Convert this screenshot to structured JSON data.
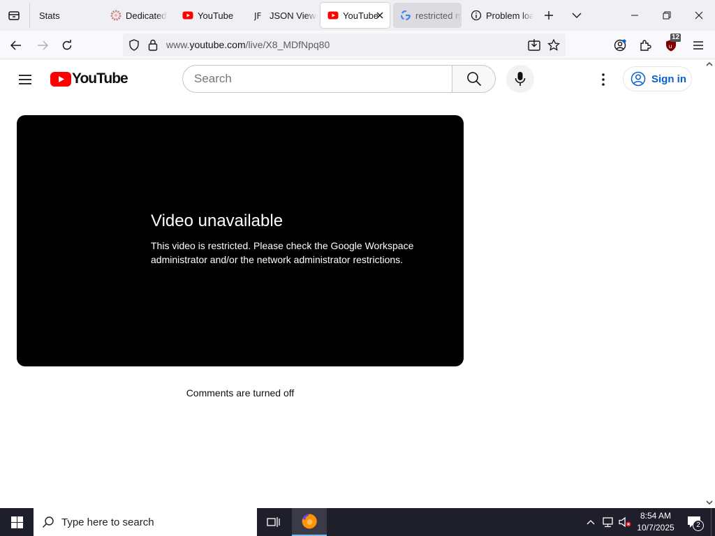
{
  "browser": {
    "tabs": [
      {
        "title": "Stats",
        "icon": "stats"
      },
      {
        "title": "Dedicated",
        "icon": "dedicated"
      },
      {
        "title": "YouTube",
        "icon": "youtube"
      },
      {
        "title": "JSON Viewer",
        "icon": "json"
      },
      {
        "title": "YouTube",
        "icon": "youtube",
        "active": true
      },
      {
        "title": "restricted mode",
        "icon": "google"
      },
      {
        "title": "Problem loading page",
        "icon": "info"
      }
    ],
    "url_prefix": "www.",
    "url_host": "youtube.com",
    "url_path": "/live/X8_MDfNpq80",
    "extension_badge": "12"
  },
  "youtube": {
    "logo_text": "YouTube",
    "search_placeholder": "Search",
    "signin_label": "Sign in",
    "error_title": "Video unavailable",
    "error_message": "This video is restricted. Please check the Google Workspace administrator and/or the network administrator restrictions.",
    "comments_status": "Comments are turned off",
    "brand_red": "#ff0000",
    "link_blue": "#065fd4"
  },
  "taskbar": {
    "search_placeholder": "Type here to search",
    "time": "8:54 AM",
    "date": "10/7/2025",
    "notification_count": "2"
  }
}
